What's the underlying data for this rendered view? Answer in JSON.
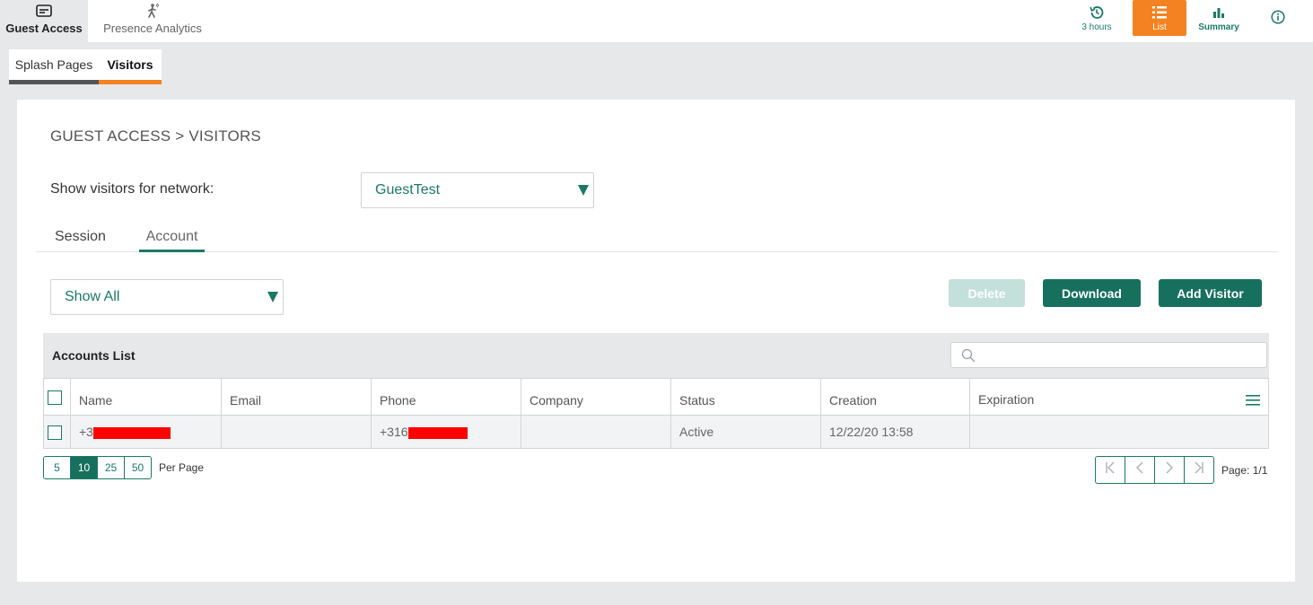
{
  "top_bar": {
    "tabs": [
      {
        "label": "Guest Access",
        "icon": "id-card-icon"
      },
      {
        "label": "Presence Analytics",
        "icon": "walking-person-icon"
      }
    ],
    "controls": {
      "time_range": "3 hours",
      "list": "List",
      "summary": "Summary",
      "info_icon": "info-icon"
    },
    "active_color": "#f58220",
    "accent_color": "#1a7a66"
  },
  "sub_tabs": [
    "Splash Pages",
    "Visitors"
  ],
  "breadcrumb": "GUEST ACCESS > VISITORS",
  "network": {
    "label": "Show visitors for network:",
    "selected": "GuestTest"
  },
  "view_tabs": [
    "Session",
    "Account"
  ],
  "filter": {
    "selected": "Show All"
  },
  "actions": {
    "delete": "Delete",
    "download": "Download",
    "add_visitor": "Add Visitor"
  },
  "table": {
    "title": "Accounts List",
    "search_placeholder": "",
    "columns": [
      "Name",
      "Email",
      "Phone",
      "Company",
      "Status",
      "Creation",
      "Expiration"
    ],
    "rows": [
      {
        "name": "+3",
        "email": "",
        "phone": "+316",
        "company": "",
        "status": "Active",
        "creation": "12/22/20 13:58",
        "expiration": ""
      }
    ]
  },
  "pagination": {
    "per_page_options": [
      "5",
      "10",
      "25",
      "50"
    ],
    "per_page_selected": "10",
    "per_page_label": "Per Page",
    "page_label": "Page: 1/1"
  }
}
